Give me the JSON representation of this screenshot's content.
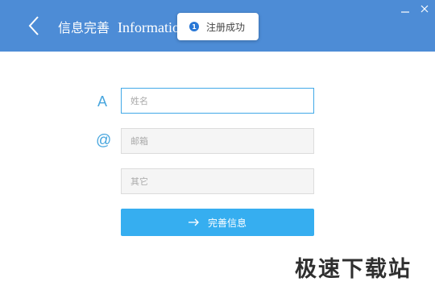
{
  "header": {
    "title_zh": "信息完善",
    "title_en": "Informatio",
    "bg_color": "#4d8cd6"
  },
  "toast": {
    "badge": "1",
    "message": "注册成功"
  },
  "form": {
    "name_label_icon": "A",
    "email_label_icon": "@",
    "name_placeholder": "姓名",
    "email_placeholder": "邮箱",
    "other_placeholder": "其它",
    "submit_label": "完善信息",
    "accent_color": "#36aef0"
  },
  "watermark": "极速下载站",
  "icons": [
    "back-arrow-icon",
    "minimize-icon",
    "close-icon",
    "info-icon",
    "arrow-right-icon"
  ]
}
